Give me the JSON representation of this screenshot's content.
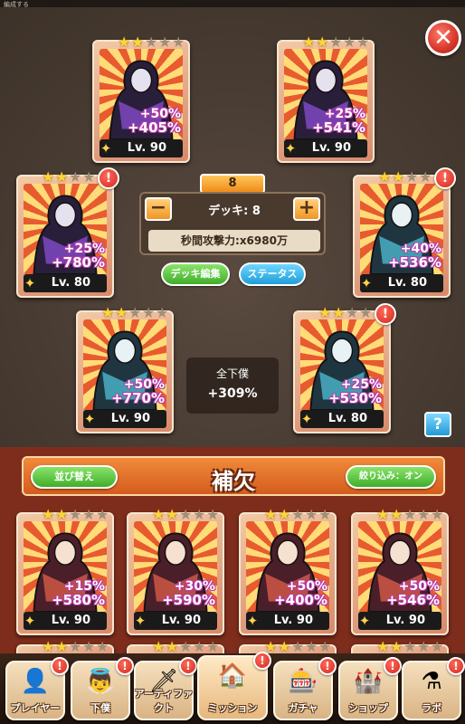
{
  "topbar": {
    "left_text": "編成する"
  },
  "deck": {
    "number": "8",
    "label": "デッキ: 8",
    "dps_label": "秒間攻撃力:x6980万",
    "edit_button": "デッキ編集",
    "status_button": "ステータス",
    "all_servants_label": "全下僕",
    "all_servants_value": "+309%"
  },
  "cards_main": [
    {
      "stat1": "+50%",
      "stat2": "+405%",
      "level": "Lv. 90",
      "stars_on": 2,
      "stars_total": 5,
      "alert": false,
      "palette": "purple"
    },
    {
      "stat1": "+25%",
      "stat2": "+541%",
      "level": "Lv. 90",
      "stars_on": 2,
      "stars_total": 5,
      "alert": false,
      "palette": "purple"
    },
    {
      "stat1": "+25%",
      "stat2": "+780%",
      "level": "Lv. 80",
      "stars_on": 2,
      "stars_total": 5,
      "alert": true,
      "palette": "purple"
    },
    {
      "stat1": "+40%",
      "stat2": "+536%",
      "level": "Lv. 80",
      "stars_on": 2,
      "stars_total": 5,
      "alert": true,
      "palette": "teal"
    },
    {
      "stat1": "+50%",
      "stat2": "+770%",
      "level": "Lv. 90",
      "stars_on": 2,
      "stars_total": 5,
      "alert": false,
      "palette": "teal"
    },
    {
      "stat1": "+25%",
      "stat2": "+530%",
      "level": "Lv. 80",
      "stars_on": 2,
      "stars_total": 5,
      "alert": true,
      "palette": "teal"
    }
  ],
  "reserve": {
    "sort_button": "並び替え",
    "title": "補欠",
    "filter_button": "絞り込み：オン",
    "cards": [
      {
        "stat1": "+15%",
        "stat2": "+580%",
        "level": "Lv. 90",
        "stars_on": 2,
        "stars_total": 5
      },
      {
        "stat1": "+30%",
        "stat2": "+590%",
        "level": "Lv. 90",
        "stars_on": 2,
        "stars_total": 5
      },
      {
        "stat1": "+50%",
        "stat2": "+400%",
        "level": "Lv. 90",
        "stars_on": 2,
        "stars_total": 5
      },
      {
        "stat1": "+50%",
        "stat2": "+546%",
        "level": "Lv. 90",
        "stars_on": 2,
        "stars_total": 5
      }
    ]
  },
  "bottom_nav": [
    {
      "label": "プレイヤー",
      "icon": "player-icon",
      "glyph": "👤",
      "alert": true
    },
    {
      "label": "下僕",
      "icon": "servant-icon",
      "glyph": "👼",
      "alert": true
    },
    {
      "label": "アーティファクト",
      "icon": "artifact-icon",
      "glyph": "🗡",
      "alert": true
    },
    {
      "label": "ミッション",
      "icon": "mission-icon",
      "glyph": "🏠",
      "alert": true
    },
    {
      "label": "ガチャ",
      "icon": "gacha-icon",
      "glyph": "🎰",
      "alert": true
    },
    {
      "label": "ショップ",
      "icon": "shop-icon",
      "glyph": "🏰",
      "alert": true
    },
    {
      "label": "ラボ",
      "icon": "lab-icon",
      "glyph": "⚗",
      "alert": true
    }
  ],
  "colors": {
    "accent": "#f08c1a",
    "alert": "#d22a1f",
    "reserve_bg": "#7e2d1c"
  }
}
